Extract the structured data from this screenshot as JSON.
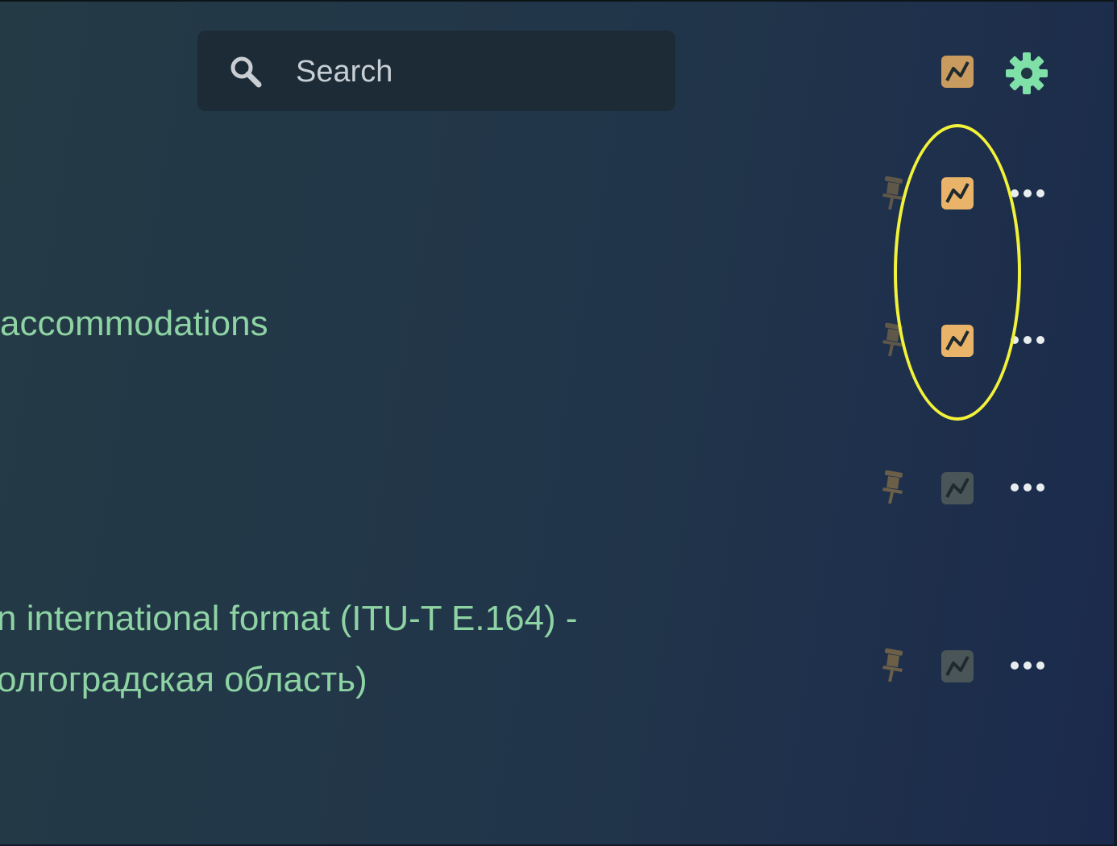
{
  "search": {
    "placeholder": "Search",
    "icon": "search-icon"
  },
  "toolbar": {
    "chart_icon": "chart-line-icon",
    "settings_icon": "gear-icon"
  },
  "colors": {
    "accent_green": "#8ed3a3",
    "gear": "#7fe0a8",
    "chart_active": "#e9b46a",
    "chart_inactive": "#4a5557",
    "pin_color": "#6b5f48",
    "highlight": "#f2f23a"
  },
  "rows": [
    {
      "text_lines": [],
      "chart_active": true
    },
    {
      "text_lines": [
        "accommodations"
      ],
      "chart_active": true
    },
    {
      "text_lines": [],
      "chart_active": false
    },
    {
      "text_lines": [
        "n international format (ITU-T E.164) -",
        "олгоградская область)"
      ],
      "chart_active": false
    }
  ],
  "row_actions": {
    "pin_icon": "pin-icon",
    "more_icon": "more-icon"
  }
}
